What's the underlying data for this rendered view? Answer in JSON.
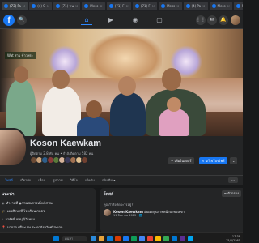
{
  "browser": {
    "tabs": [
      {
        "label": "(73) Fa",
        "icon": "facebook-icon"
      },
      {
        "label": "(4) S",
        "icon": "facebook-icon"
      },
      {
        "label": "(71) หน",
        "icon": "facebook-icon"
      },
      {
        "label": "Mess",
        "icon": "facebook-icon"
      },
      {
        "label": "(71) F",
        "icon": "facebook-icon"
      },
      {
        "label": "(71) F",
        "icon": "facebook-icon"
      },
      {
        "label": "Mess",
        "icon": "facebook-icon"
      },
      {
        "label": "(4) Pa",
        "icon": "facebook-icon"
      },
      {
        "label": "Mess",
        "icon": "facebook-icon"
      },
      {
        "label": "Mess",
        "icon": "facebook-icon"
      },
      {
        "label": "Mess",
        "icon": "facebook-icon"
      },
      {
        "label": "Mess",
        "icon": "facebook-icon"
      }
    ]
  },
  "fbnav": {
    "logo": "f",
    "search_icon": "🔍",
    "home_icon": "⌂",
    "video_icon": "▶",
    "groups_icon": "◉",
    "gaming_icon": "▢",
    "menu_icon": "⋮⋮",
    "messenger_icon": "✉",
    "notifications_icon": "🔔"
  },
  "cover": {
    "sign_text": "Wat สาม ข้าวพระ"
  },
  "profile": {
    "name": "Koson Kaewkam",
    "friends_text": "ผู้ติดตาม 2.8 พัน คน • กำลังติดตาม 582 คน",
    "friend_face_colors": [
      "#6b4a34",
      "#c9a27a",
      "#2e5e8a",
      "#8a3a3a",
      "#5a7a3a",
      "#d6b39a",
      "#3a3a5a",
      "#a07050",
      "#e0c090",
      "#704030"
    ],
    "story_button": "+ เพิ่มในสตอรี่",
    "edit_button": "✎ แก้ไขโปรไฟล์",
    "chevron": "⌄"
  },
  "profile_tabs": {
    "items": [
      "โพสต์",
      "เกี่ยวกับ",
      "เพื่อน",
      "รูปภาพ",
      "วิดีโอ",
      "เช็คอิน",
      "เพิ่มเติม ▾"
    ],
    "more_label": "···"
  },
  "intro": {
    "title": "แนะนำ",
    "rows": [
      {
        "icon": "◉",
        "text": "ทำงานที่ ◉ชวนชมการเลี้ยงไก่ชน"
      },
      {
        "icon": "🎓",
        "text": "เคยศึกษาที่ โรงเรียนเกษตร"
      },
      {
        "icon": "⌂",
        "text": "อาศัยที่ ชลบุรี/วังหอม"
      },
      {
        "icon": "📍",
        "text": "มาจาก ศรีสะเกษ สะเดาจังหวัดศรีสะเกษ"
      }
    ]
  },
  "posts": {
    "title": "โพสต์",
    "filter_label": "≡ ตัวกรอง",
    "prompt": "คุณกำลังคิดอะไรอยู่?",
    "item": {
      "author": "Koson Kaewkam",
      "action": " อัปเดตรูปภาพหน้าปกของเขา",
      "date": "11 สิงหาคม 2022 · 🌐"
    }
  },
  "taskbar": {
    "search_placeholder": "ค้นหา",
    "time": "17:38",
    "date": "15/8/2565",
    "icon_colors": [
      "#2b88d8",
      "#e8a33b",
      "#0a7bd4",
      "#d83b01",
      "#1877f2",
      "#0f9d58",
      "#4285f4",
      "#e94235",
      "#fbbc04",
      "#34a853",
      "#0078d4",
      "#5c2d91",
      "#00a4ef"
    ]
  }
}
